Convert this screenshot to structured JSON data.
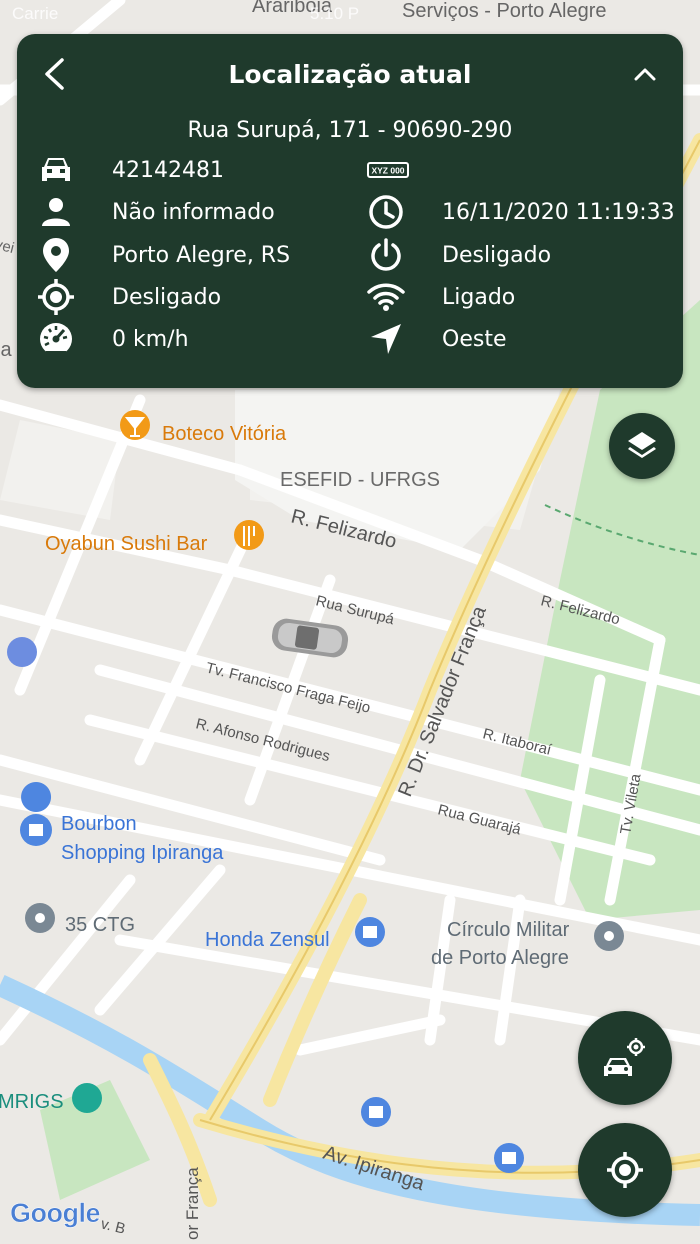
{
  "status_bar": {
    "carrier": "Carrie",
    "time": "5:10 P",
    "wifi_icon": "wifi-icon",
    "battery_icon": "battery-icon"
  },
  "card": {
    "title": "Localização atual",
    "address": "Rua Surupá, 171 - 90690-290",
    "back_icon": "chevron-left-icon",
    "collapse_icon": "chevron-up-icon",
    "rows_left": [
      {
        "icon": "car-icon",
        "value": "42142481"
      },
      {
        "icon": "person-icon",
        "value": "Não informado"
      },
      {
        "icon": "location-pin-icon",
        "value": "Porto Alegre, RS"
      },
      {
        "icon": "gps-target-icon",
        "value": "Desligado"
      },
      {
        "icon": "speedometer-icon",
        "value": "0 km/h"
      }
    ],
    "rows_right": [
      {
        "icon": "license-plate-icon",
        "value": "",
        "plate_text": "XYZ 000"
      },
      {
        "icon": "clock-icon",
        "value": "16/11/2020 11:19:33"
      },
      {
        "icon": "power-icon",
        "value": "Desligado"
      },
      {
        "icon": "wifi-icon",
        "value": "Ligado"
      },
      {
        "icon": "navigation-arrow-icon",
        "value": "Oeste"
      }
    ]
  },
  "map": {
    "top_labels": {
      "arariboia": "Arariboia",
      "servicos": "Serviços - Porto Alegre",
      "otav": "Ota"
    },
    "left_edge": {
      "veir": "vei",
      "ia": "ia"
    },
    "places": {
      "boteco": "Boteco Vitória",
      "esefid": "ESEFID - UFRGS",
      "oyabun": "Oyabun Sushi Bar",
      "bourbon_line1": "Bourbon",
      "bourbon_line2": "Shopping Ipiranga",
      "ctg": "35 CTG",
      "honda": "Honda Zensul",
      "circulo_line1": "Círculo Militar",
      "circulo_line2": "de Porto Alegre",
      "mrigs": "MRIGS"
    },
    "streets": {
      "felizardo1": "R. Felizardo",
      "felizardo2": "R. Felizardo",
      "surupa": "Rua Surupá",
      "fraga": "Tv. Francisco Fraga Feijo",
      "afonso": "R. Afonso Rodrigues",
      "salvador": "R. Dr. Salvador França",
      "itaborai": "R. Itaboraí",
      "guaraja": "Rua Guarajá",
      "vileta": "Tv. Vileta",
      "ipiranga": "Av. Ipiranga",
      "orfranca": "or França",
      "vb": "v. B"
    },
    "watermark": "Google"
  },
  "buttons": {
    "layers_icon": "layers-icon",
    "vehicle_locate_icon": "car-locate-icon",
    "my_location_icon": "my-location-icon"
  },
  "colors": {
    "card_bg": "#1f3a2c",
    "major_road": "#f7e6a1",
    "river": "#a8d4f5",
    "park": "#c8e6c0"
  }
}
